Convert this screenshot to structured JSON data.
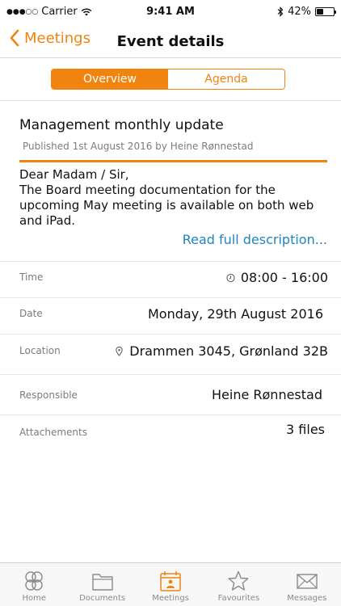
{
  "status_bar": {
    "carrier": "Carrier",
    "signal_dots": "●●●○○",
    "time": "9:41 AM",
    "battery_percent": "42%",
    "battery_level": 0.42
  },
  "nav": {
    "back_label": "Meetings",
    "title": "Event details"
  },
  "segments": {
    "overview": "Overview",
    "agenda": "Agenda"
  },
  "event": {
    "title": "Management monthly update",
    "published": "Published 1st August 2016 by Heine Rønnestad",
    "description": "Dear Madam / Sir,\nThe Board meeting documentation for the upcoming May meeting is available on both web and iPad.",
    "read_more": "Read full description..."
  },
  "details": {
    "time_label": "Time",
    "time_value": "08:00 - 16:00",
    "date_label": "Date",
    "date_value": "Monday, 29th August 2016",
    "location_label": "Location",
    "location_value": "Drammen 3045, Grønland 32B",
    "responsible_label": "Responsible",
    "responsible_value": "Heine Rønnestad",
    "attachments_label": "Attachements",
    "attachments_value": "3 files"
  },
  "tabs": [
    {
      "label": "Home",
      "icon": "home-icon"
    },
    {
      "label": "Documents",
      "icon": "folder-icon"
    },
    {
      "label": "Meetings",
      "icon": "calendar-icon"
    },
    {
      "label": "Favourites",
      "icon": "star-icon"
    },
    {
      "label": "Messages",
      "icon": "envelope-icon"
    }
  ],
  "colors": {
    "accent": "#f0840f",
    "link": "#1f84c3",
    "muted": "#7b7b7b"
  }
}
